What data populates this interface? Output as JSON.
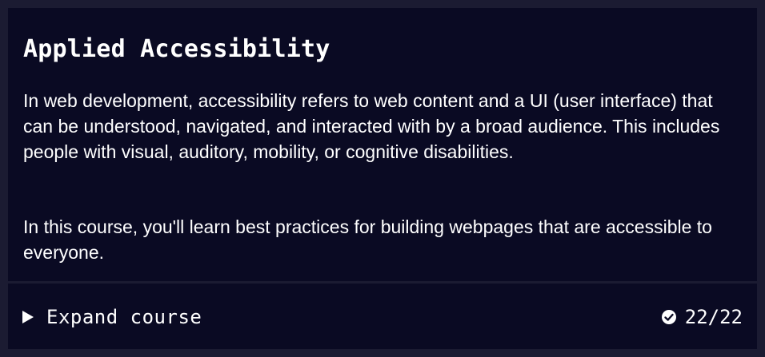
{
  "course": {
    "title": "Applied Accessibility",
    "paragraphs": [
      "In web development, accessibility refers to web content and a UI (user interface) that can be understood, navigated, and interacted with by a broad audience. This includes people with visual, auditory, mobility, or cognitive disabilities.",
      "In this course, you'll learn best practices for building webpages that are accessible to everyone."
    ]
  },
  "footer": {
    "expand_label": "Expand course",
    "expand_icon": "caret-right-icon",
    "progress_icon": "check-circle-icon",
    "progress_text": "22/22"
  },
  "colors": {
    "page_background": "#1b1b32",
    "card_background": "#0a0a23",
    "text": "#ffffff"
  }
}
